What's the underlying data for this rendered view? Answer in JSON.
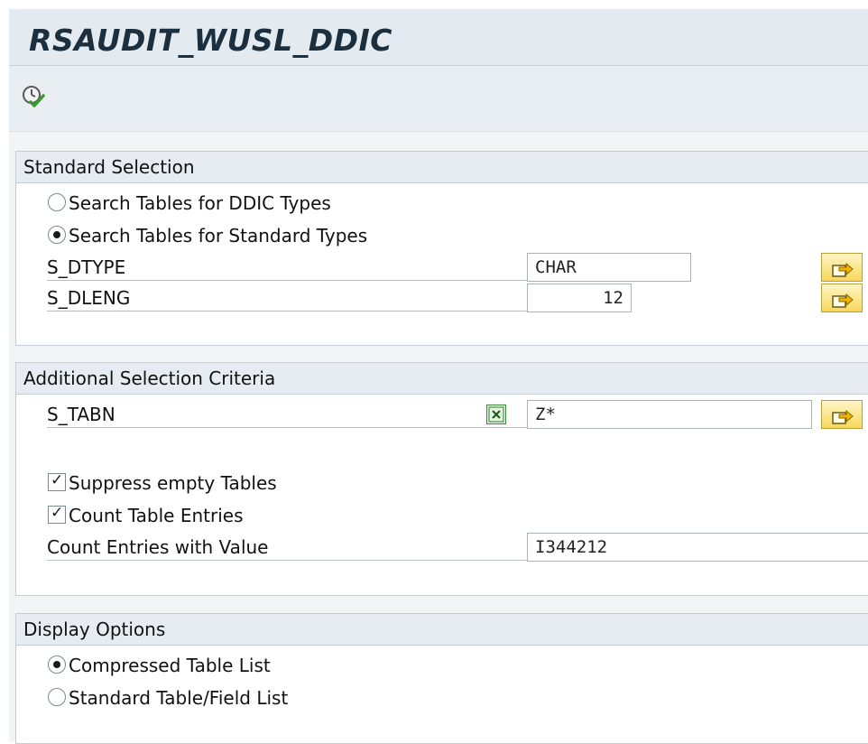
{
  "header": {
    "title": "RSAUDIT_WUSL_DDIC"
  },
  "toolbar": {
    "execute_icon": "execute-clock-check-icon"
  },
  "standard_selection": {
    "title": "Standard Selection",
    "radio_ddic_label": "Search Tables for DDIC Types",
    "radio_ddic_selected": false,
    "radio_std_label": "Search Tables for Standard Types",
    "radio_std_selected": true,
    "dtype_label": "S_DTYPE",
    "dtype_value": "CHAR",
    "dleng_label": "S_DLENG",
    "dleng_value": "12"
  },
  "additional_selection": {
    "title": "Additional Selection Criteria",
    "tabn_label": "S_TABN",
    "tabn_value": "Z*",
    "suppress_label": "Suppress empty Tables",
    "suppress_checked": true,
    "count_label": "Count Table Entries",
    "count_checked": true,
    "count_value_label": "Count Entries with Value",
    "count_value": "I344212"
  },
  "display_options": {
    "title": "Display Options",
    "compressed_label": "Compressed Table List",
    "compressed_selected": true,
    "standard_list_label": "Standard Table/Field List",
    "standard_list_selected": false
  },
  "colors": {
    "title_bar": "#e3eaf0",
    "group_header": "#e6ecf1",
    "multiple_selection_button": "#f7d85b"
  }
}
